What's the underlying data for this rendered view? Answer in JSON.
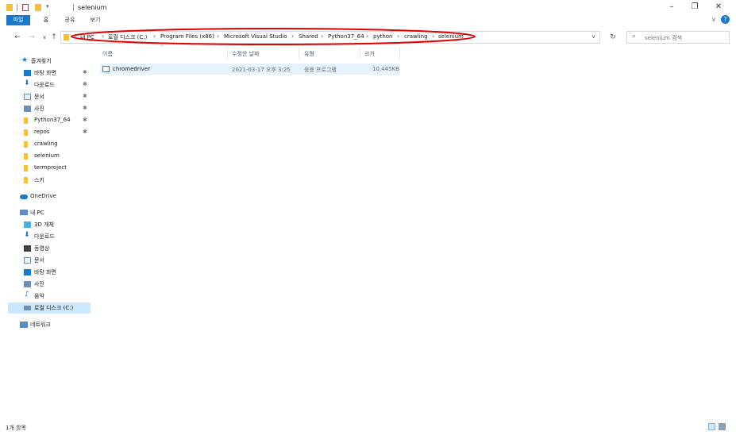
{
  "window": {
    "title": "selenium",
    "minimize_icon": "minimize-icon",
    "restore_icon": "restore-icon",
    "close_icon": "close-icon"
  },
  "ribbon": {
    "tabs": [
      "파일",
      "홈",
      "공유",
      "보기"
    ]
  },
  "address": {
    "crumbs": [
      "내 PC",
      "로컬 디스크 (C:)",
      "Program Files (x86)",
      "Microsoft Visual Studio",
      "Shared",
      "Python37_64",
      "python",
      "crawling",
      "selenium"
    ]
  },
  "search": {
    "placeholder": "selenium 검색"
  },
  "sidebar": {
    "quick_access": "즐겨찾기",
    "quick_items": [
      {
        "label": "바탕 화면",
        "pinned": true
      },
      {
        "label": "다운로드",
        "pinned": true
      },
      {
        "label": "문서",
        "pinned": true
      },
      {
        "label": "사진",
        "pinned": true
      },
      {
        "label": "Python37_64",
        "pinned": true
      },
      {
        "label": "repos",
        "pinned": true
      },
      {
        "label": "crawling",
        "pinned": false
      },
      {
        "label": "selenium",
        "pinned": false
      },
      {
        "label": "termproject",
        "pinned": false
      },
      {
        "label": "스키",
        "pinned": false
      }
    ],
    "onedrive": "OneDrive",
    "this_pc": "내 PC",
    "pc_items": [
      "3D 개체",
      "다운로드",
      "동영상",
      "문서",
      "바탕 화면",
      "사진",
      "음악",
      "로컬 디스크 (C:)"
    ],
    "network": "네트워크"
  },
  "columns": {
    "name": "이름",
    "modified": "수정한 날짜",
    "type": "유형",
    "size": "크기"
  },
  "files": [
    {
      "name": "chromedriver",
      "modified": "2021-03-17 오후 3:25",
      "type": "응용 프로그램",
      "size": "10,445KB"
    }
  ],
  "status": {
    "count": "1개 항목"
  },
  "colors": {
    "file_tab": "#1979ca",
    "selection": "#cce8ff",
    "annotation": "#e00000"
  }
}
